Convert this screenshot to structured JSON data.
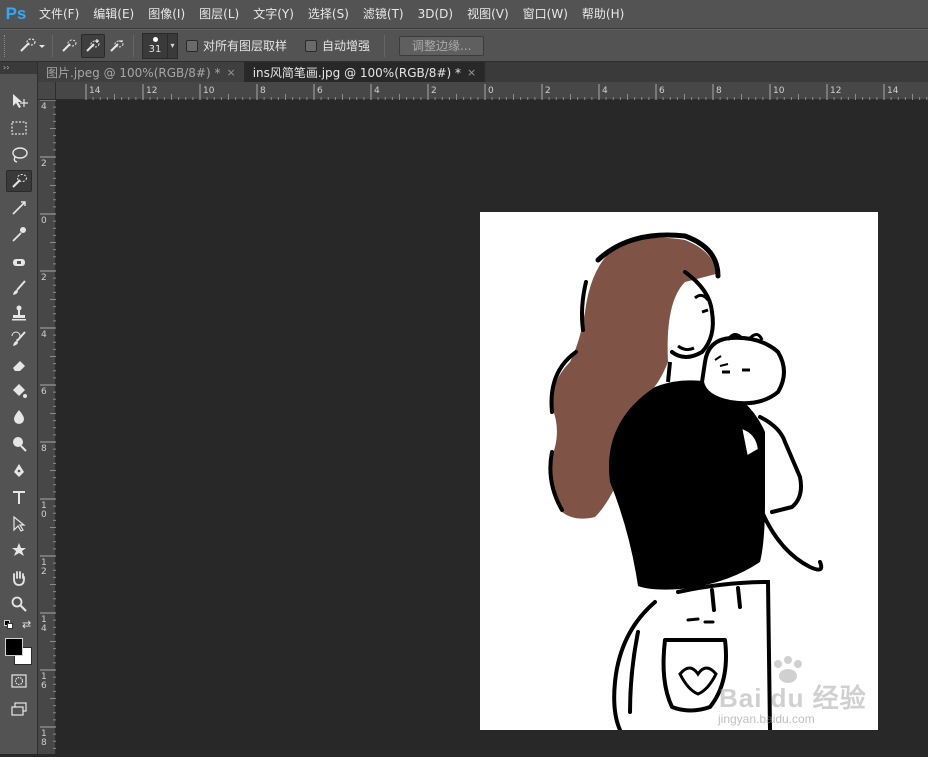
{
  "app": {
    "logo": "Ps"
  },
  "menu": [
    "文件(F)",
    "编辑(E)",
    "图像(I)",
    "图层(L)",
    "文字(Y)",
    "选择(S)",
    "滤镜(T)",
    "3D(D)",
    "视图(V)",
    "窗口(W)",
    "帮助(H)"
  ],
  "options": {
    "brush_size": "31",
    "sample_all_layers": "对所有图层取样",
    "auto_enhance": "自动增强",
    "refine_edge": "调整边缘..."
  },
  "tabs": [
    {
      "label": "图片.jpeg @ 100%(RGB/8#) *",
      "close": "×",
      "active": false
    },
    {
      "label": "ins风简笔画.jpg @ 100%(RGB/8#) *",
      "close": "×",
      "active": true
    }
  ],
  "ruler": {
    "top_labels": [
      "14",
      "12",
      "10",
      "8",
      "6",
      "4",
      "2",
      "0",
      "2",
      "4",
      "6",
      "8",
      "10",
      "12",
      "14"
    ],
    "left_labels": [
      "4",
      "2",
      "0",
      "2",
      "4",
      "6",
      "8",
      "1\n0",
      "1\n2",
      "1\n4",
      "1\n6",
      "1\n8"
    ]
  },
  "toolbox": {
    "header": "››"
  },
  "colors": {
    "foreground": "#000000",
    "background": "#ffffff",
    "hair": "#7f5446",
    "accent": "#31a8ff"
  },
  "watermark": {
    "text": "Bai du 经验",
    "url": "jingyan.baidu.com"
  }
}
